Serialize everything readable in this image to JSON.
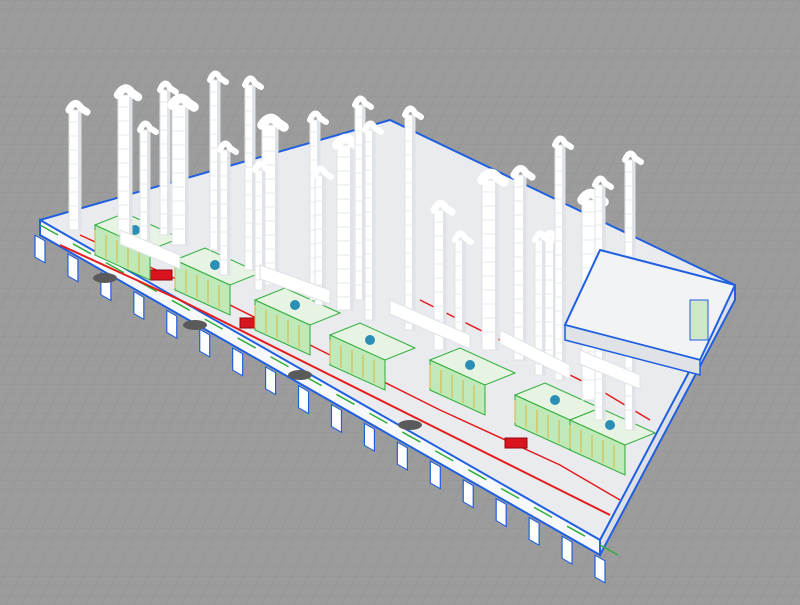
{
  "scene": {
    "subject": "isometric-factory-paint-line-model",
    "colors": {
      "floor": "#9c9c9c",
      "floor_grid": "#8e8e8e",
      "wall_white": "#f4f5f6",
      "wall_shadow": "#d9dcdf",
      "outline_blue": "#1f5fe0",
      "conveyor_red": "#e41c1c",
      "pipe_green": "#2fae3a",
      "cabin_green": "#bfe9b8",
      "railing_yellow": "#e2b23a",
      "fan_teal": "#2b8fb5",
      "duct_white": "#ffffff",
      "duct_shade": "#dfe2e6",
      "car_red": "#d9141f",
      "tank_dark": "#5a5a5a"
    }
  }
}
